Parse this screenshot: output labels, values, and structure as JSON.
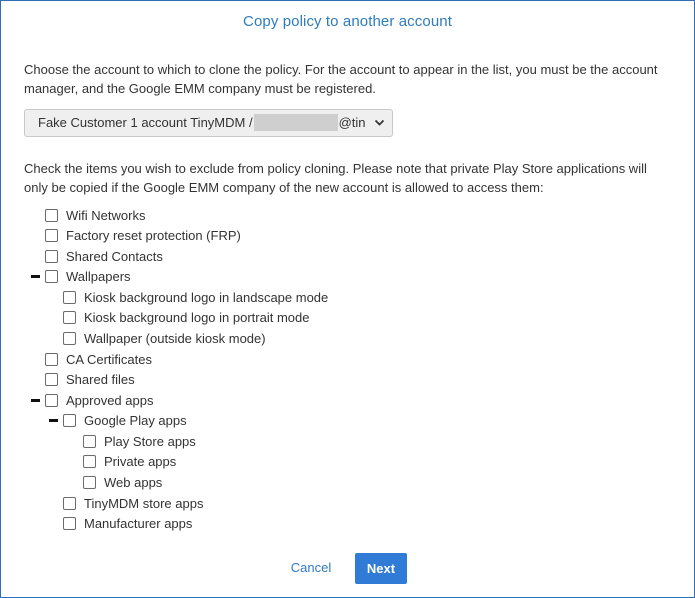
{
  "dialog": {
    "title": "Copy policy to another account",
    "intro": "Choose the account to which to clone the policy. For the account to appear in the list, you must be the account manager, and the Google EMM company must be registered.",
    "account_select": {
      "value_prefix": "Fake Customer 1 account TinyMDM /",
      "value_suffix": "@tin",
      "icon": "chevron-down-icon"
    },
    "instructions": "Check the items you wish to exclude from policy cloning. Please note that private Play Store applications will only be copied if the Google EMM company of the new account is allowed to access them:",
    "items": {
      "wifi": "Wifi Networks",
      "frp": "Factory reset protection (FRP)",
      "contacts": "Shared Contacts",
      "wallpapers": "Wallpapers",
      "kiosk_landscape": "Kiosk background logo in landscape mode",
      "kiosk_portrait": "Kiosk background logo in portrait mode",
      "wallpaper_outside": "Wallpaper (outside kiosk mode)",
      "ca_certs": "CA Certificates",
      "shared_files": "Shared files",
      "approved_apps": "Approved apps",
      "google_play_apps": "Google Play apps",
      "play_store_apps": "Play Store apps",
      "private_apps": "Private apps",
      "web_apps": "Web apps",
      "tinymdm_store_apps": "TinyMDM store apps",
      "manufacturer_apps": "Manufacturer apps"
    },
    "buttons": {
      "cancel": "Cancel",
      "next": "Next"
    },
    "colors": {
      "accent": "#2f7bbf",
      "primary_button": "#2f7bd6",
      "border": "#2f6fb5"
    }
  }
}
